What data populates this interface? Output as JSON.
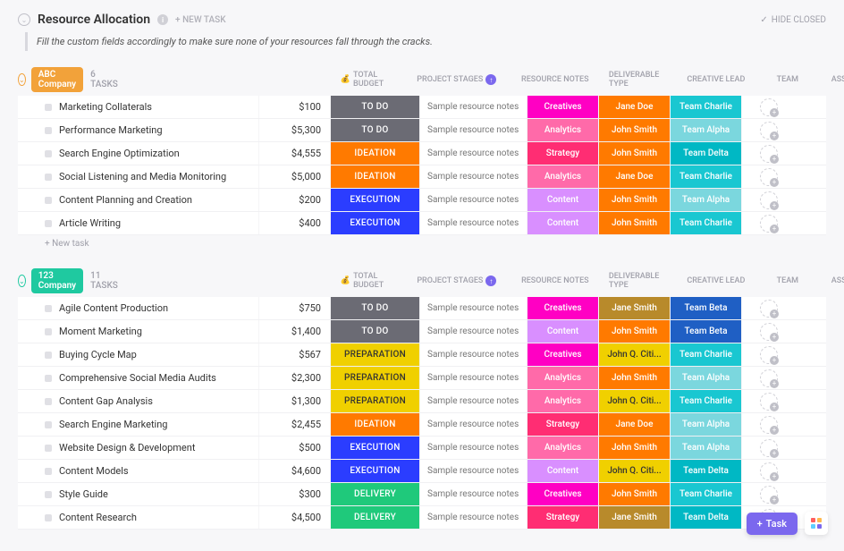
{
  "header": {
    "title": "Resource Allocation",
    "new_task": "+ NEW TASK",
    "hide_closed": "HIDE CLOSED"
  },
  "subtitle": "Fill the custom fields accordingly to make sure none of your resources fall through the cracks.",
  "columns": {
    "budget": "TOTAL BUDGET",
    "stages": "PROJECT STAGES",
    "notes": "RESOURCE NOTES",
    "deliverable": "DELIVERABLE TYPE",
    "lead": "CREATIVE LEAD",
    "team": "TEAM",
    "assignee": "ASSIGNEE"
  },
  "new_task_row": "+ New task",
  "floating": {
    "task": "Task"
  },
  "stage_colors": {
    "TO DO": "#6b6b74",
    "IDEATION": "#ff7a00",
    "EXECUTION": "#2b3dff",
    "PREPARATION": "#f0d000",
    "DELIVERY": "#1fc97b"
  },
  "deliverable_colors": {
    "Creatives": "#ff00c3",
    "Analytics": "#ff6aa9",
    "Strategy": "#ff2d73",
    "Content": "#d98fff"
  },
  "lead_colors": {
    "Jane Doe": "#ff7a00",
    "John Smith": "#ff7a00",
    "Jane Smith": "#b88a2b",
    "John Q. Citi...": "#f0d000"
  },
  "team_colors": {
    "Team Charlie": "#19c7d1",
    "Team Alpha": "#7bd7de",
    "Team Delta": "#00b8c4",
    "Team Beta": "#1f5fc4"
  },
  "groups": [
    {
      "name": "ABC Company",
      "color": "#f2a23a",
      "count": "6 TASKS",
      "tasks": [
        {
          "name": "Marketing Collaterals",
          "budget": "$100",
          "stage": "TO DO",
          "notes": "Sample resource notes",
          "deliverable": "Creatives",
          "lead": "Jane Doe",
          "team": "Team Charlie"
        },
        {
          "name": "Performance Marketing",
          "budget": "$5,300",
          "stage": "TO DO",
          "notes": "Sample resource notes",
          "deliverable": "Analytics",
          "lead": "John Smith",
          "team": "Team Alpha"
        },
        {
          "name": "Search Engine Optimization",
          "budget": "$4,555",
          "stage": "IDEATION",
          "notes": "Sample resource notes",
          "deliverable": "Strategy",
          "lead": "John Smith",
          "team": "Team Delta"
        },
        {
          "name": "Social Listening and Media Monitoring",
          "budget": "$5,000",
          "stage": "IDEATION",
          "notes": "Sample resource notes",
          "deliverable": "Analytics",
          "lead": "Jane Doe",
          "team": "Team Charlie"
        },
        {
          "name": "Content Planning and Creation",
          "budget": "$200",
          "stage": "EXECUTION",
          "notes": "Sample resource notes",
          "deliverable": "Content",
          "lead": "John Smith",
          "team": "Team Alpha"
        },
        {
          "name": "Article Writing",
          "budget": "$400",
          "stage": "EXECUTION",
          "notes": "Sample resource notes",
          "deliverable": "Content",
          "lead": "John Smith",
          "team": "Team Charlie"
        }
      ]
    },
    {
      "name": "123 Company",
      "color": "#1fc9a0",
      "count": "11 TASKS",
      "tasks": [
        {
          "name": "Agile Content Production",
          "budget": "$750",
          "stage": "TO DO",
          "notes": "Sample resource notes",
          "deliverable": "Creatives",
          "lead": "Jane Smith",
          "team": "Team Beta"
        },
        {
          "name": "Moment Marketing",
          "budget": "$1,400",
          "stage": "TO DO",
          "notes": "Sample resource notes",
          "deliverable": "Content",
          "lead": "John Smith",
          "team": "Team Beta"
        },
        {
          "name": "Buying Cycle Map",
          "budget": "$567",
          "stage": "PREPARATION",
          "notes": "Sample resource notes",
          "deliverable": "Creatives",
          "lead": "John Q. Citi...",
          "team": "Team Charlie"
        },
        {
          "name": "Comprehensive Social Media Audits",
          "budget": "$2,300",
          "stage": "PREPARATION",
          "notes": "Sample resource notes",
          "deliverable": "Analytics",
          "lead": "John Smith",
          "team": "Team Alpha"
        },
        {
          "name": "Content Gap Analysis",
          "budget": "$1,300",
          "stage": "PREPARATION",
          "notes": "Sample resource notes",
          "deliverable": "Analytics",
          "lead": "John Q. Citi...",
          "team": "Team Charlie"
        },
        {
          "name": "Search Engine Marketing",
          "budget": "$2,455",
          "stage": "IDEATION",
          "notes": "Sample resource notes",
          "deliverable": "Strategy",
          "lead": "Jane Doe",
          "team": "Team Alpha"
        },
        {
          "name": "Website Design & Development",
          "budget": "$500",
          "stage": "EXECUTION",
          "notes": "Sample resource notes",
          "deliverable": "Analytics",
          "lead": "John Smith",
          "team": "Team Alpha"
        },
        {
          "name": "Content Models",
          "budget": "$4,600",
          "stage": "EXECUTION",
          "notes": "Sample resource notes",
          "deliverable": "Content",
          "lead": "John Q. Citi...",
          "team": "Team Delta"
        },
        {
          "name": "Style Guide",
          "budget": "$300",
          "stage": "DELIVERY",
          "notes": "Sample resource notes",
          "deliverable": "Creatives",
          "lead": "John Smith",
          "team": "Team Charlie"
        },
        {
          "name": "Content Research",
          "budget": "$4,500",
          "stage": "DELIVERY",
          "notes": "Sample resource notes",
          "deliverable": "Strategy",
          "lead": "Jane Smith",
          "team": "Team Delta"
        }
      ]
    }
  ]
}
